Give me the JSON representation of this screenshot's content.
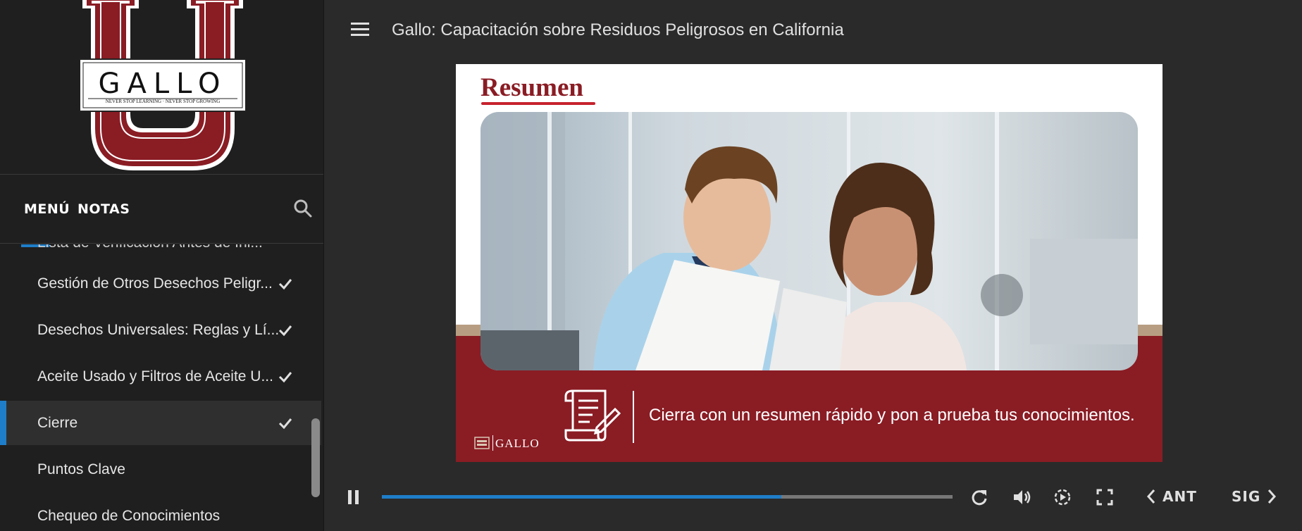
{
  "sidebar": {
    "logo_text": "GALLO",
    "logo_tagline": "NEVER STOP LEARNING · NEVER STOP GROWING",
    "tabs": {
      "menu": "MENÚ",
      "notes": "NOTAS"
    },
    "partial_item": "Lista de Verificación Antes de Ini...",
    "items": [
      {
        "label": "Gestión de Otros Desechos Peligr...",
        "completed": true,
        "active": false
      },
      {
        "label": "Desechos Universales: Reglas y Lí...",
        "completed": true,
        "active": false
      },
      {
        "label": "Aceite Usado y Filtros de Aceite U...",
        "completed": true,
        "active": false
      },
      {
        "label": "Cierre",
        "completed": true,
        "active": true
      },
      {
        "label": "Puntos Clave",
        "completed": false,
        "active": false
      },
      {
        "label": "Chequeo de Conocimientos",
        "completed": false,
        "active": false
      }
    ]
  },
  "header": {
    "course_title": "Gallo: Capacitación sobre Residuos Peligrosos en California"
  },
  "slide": {
    "title": "Resumen",
    "caption": "Cierra con un resumen rápido y pon a prueba tus conocimientos.",
    "brand": "GALLO"
  },
  "player": {
    "progress": 0.7,
    "prev_label": "ANT",
    "next_label": "SIG"
  },
  "colors": {
    "accent_blue": "#1f7ec9",
    "brand_red": "#8a1c24",
    "sidebar_bg": "#1f1f1f",
    "main_bg": "#2a2a2a"
  },
  "icons": [
    "search-icon",
    "check-icon",
    "hamburger-icon",
    "pause-icon",
    "replay-icon",
    "volume-icon",
    "playback-speed-icon",
    "fullscreen-icon",
    "chevron-left-icon",
    "chevron-right-icon",
    "document-icon"
  ]
}
